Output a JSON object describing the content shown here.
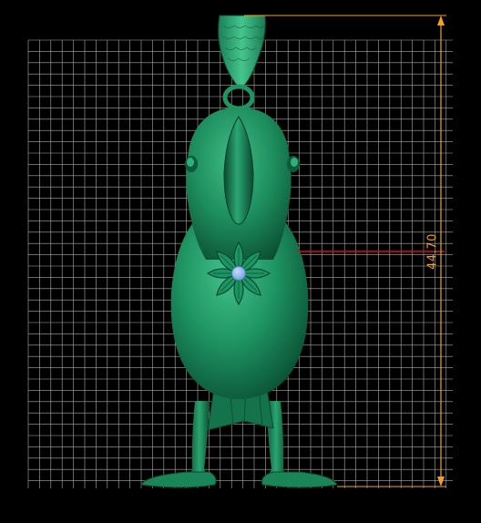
{
  "viewport": {
    "background": "#000000",
    "grid_color": "#c9c9c9",
    "model_color": "#1e8f5e",
    "gem_color": "#8fb8e8",
    "dimension_color": "#f2a31a",
    "reference_line_color": "#d0141a"
  },
  "dimension": {
    "value": "44.70",
    "icon": "height-dimension-icon"
  }
}
